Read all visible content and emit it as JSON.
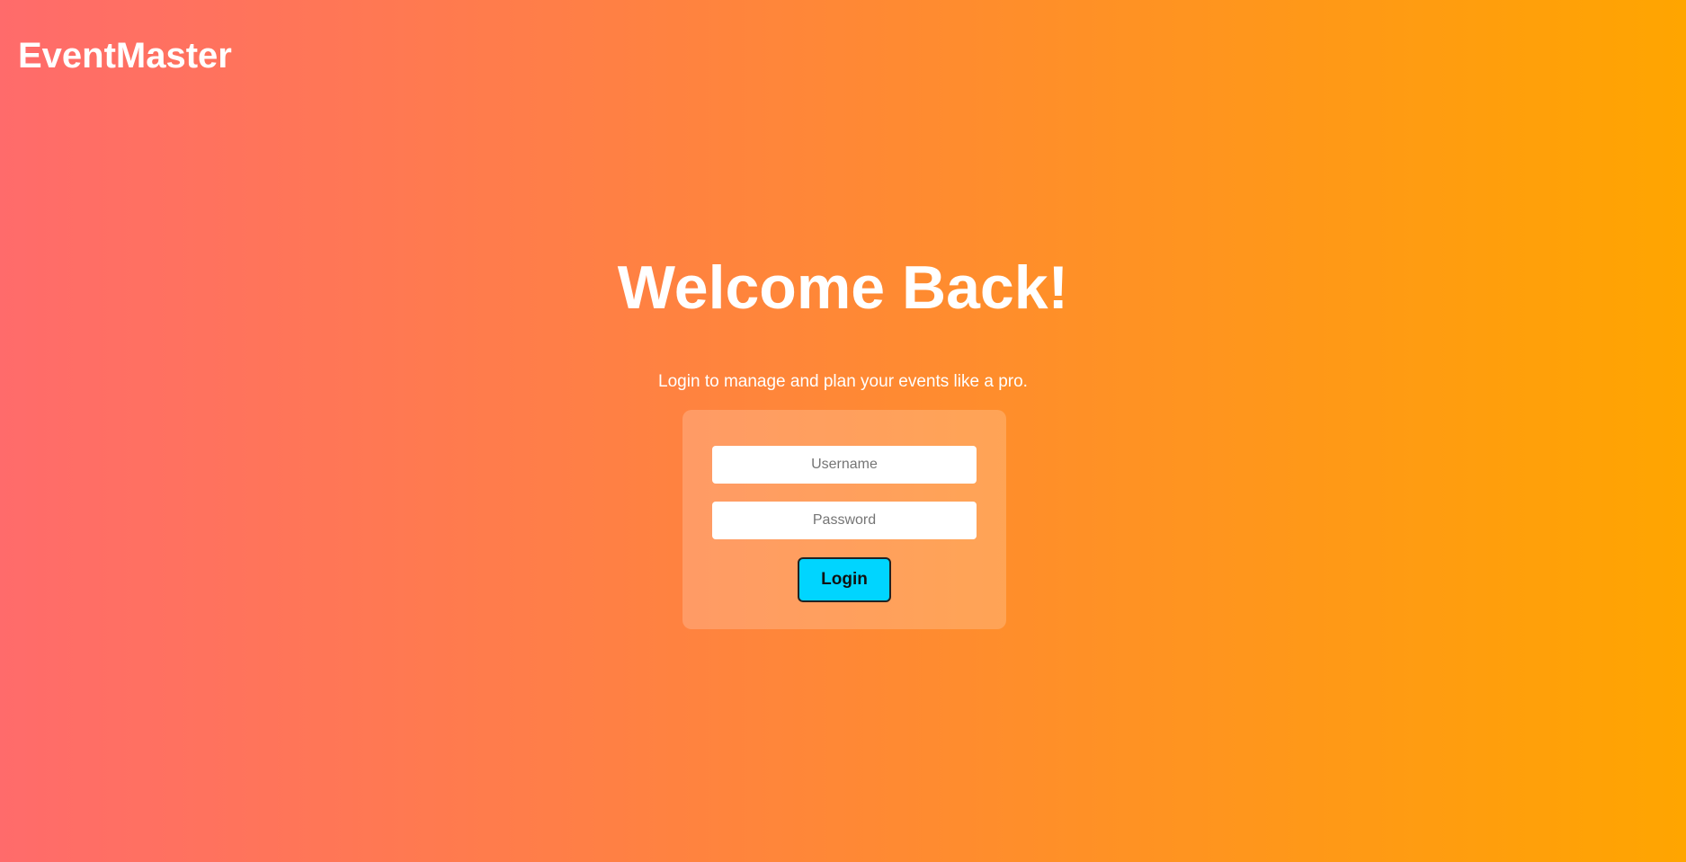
{
  "header": {
    "brand": "EventMaster"
  },
  "hero": {
    "title": "Welcome Back!",
    "subtitle": "Login to manage and plan your events like a pro."
  },
  "login_form": {
    "username_placeholder": "Username",
    "password_placeholder": "Password",
    "submit_label": "Login"
  },
  "colors": {
    "gradient_start": "#ff6b6b",
    "gradient_end": "#ffa500",
    "button_background": "#00d5ff"
  }
}
